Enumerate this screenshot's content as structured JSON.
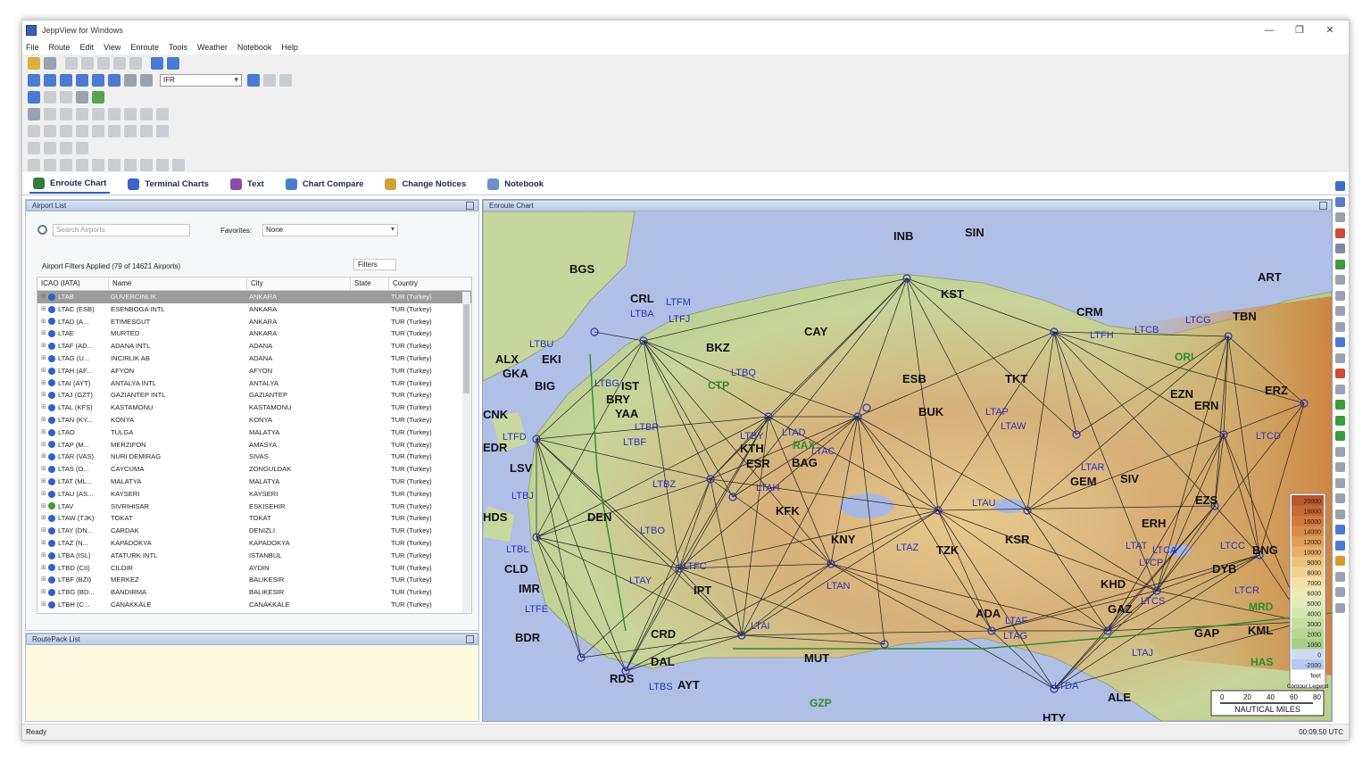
{
  "window": {
    "title": "JeppView for Windows",
    "controls": {
      "minimize": "—",
      "maximize": "❐",
      "close": "✕"
    }
  },
  "menu": [
    "File",
    "Route",
    "Edit",
    "View",
    "Enroute",
    "Tools",
    "Weather",
    "Notebook",
    "Help"
  ],
  "toolbar": {
    "layer_select": "IFR"
  },
  "tabs": [
    {
      "label": "Enroute Chart",
      "icon": "globe-icon",
      "color": "#2f7d3a"
    },
    {
      "label": "Terminal Charts",
      "icon": "terminal-charts-icon",
      "color": "#3866c6"
    },
    {
      "label": "Text",
      "icon": "text-icon",
      "color": "#8a4aa8"
    },
    {
      "label": "Chart Compare",
      "icon": "chart-compare-icon",
      "color": "#4a7bd0"
    },
    {
      "label": "Change Notices",
      "icon": "change-notices-icon",
      "color": "#d0a23a"
    },
    {
      "label": "Notebook",
      "icon": "notebook-icon",
      "color": "#6b8fc9"
    }
  ],
  "airport_panel": {
    "title": "Airport List",
    "search_placeholder": "Search Airports",
    "favorites_label": "Favorites:",
    "favorites_value": "None",
    "filter_status": "Airport Filters Applied (79 of 14621 Airports)",
    "filters_button": "Filters",
    "columns": [
      "ICAO (IATA)",
      "Name",
      "City",
      "State",
      "Country"
    ],
    "rows": [
      {
        "icao": "LTAB",
        "name": "GUVERCINLIK",
        "city": "ANKARA",
        "state": "",
        "country": "TUR (Turkey)",
        "selected": true
      },
      {
        "icao": "LTAC (ESB)",
        "name": "ESENBOGA INTL",
        "city": "ANKARA",
        "state": "",
        "country": "TUR (Turkey)"
      },
      {
        "icao": "LTAD (A...",
        "name": "ETIMESGUT",
        "city": "ANKARA",
        "state": "",
        "country": "TUR (Turkey)"
      },
      {
        "icao": "LTAE",
        "name": "MURTED",
        "city": "ANKARA",
        "state": "",
        "country": "TUR (Turkey)"
      },
      {
        "icao": "LTAF (AD...",
        "name": "ADANA INTL",
        "city": "ADANA",
        "state": "",
        "country": "TUR (Turkey)"
      },
      {
        "icao": "LTAG (U...",
        "name": "INCIRLIK AB",
        "city": "ADANA",
        "state": "",
        "country": "TUR (Turkey)"
      },
      {
        "icao": "LTAH (AF...",
        "name": "AFYON",
        "city": "AFYON",
        "state": "",
        "country": "TUR (Turkey)"
      },
      {
        "icao": "LTAI (AYT)",
        "name": "ANTALYA INTL",
        "city": "ANTALYA",
        "state": "",
        "country": "TUR (Turkey)"
      },
      {
        "icao": "LTAJ (GZT)",
        "name": "GAZIANTEP INTL",
        "city": "GAZIANTEP",
        "state": "",
        "country": "TUR (Turkey)"
      },
      {
        "icao": "LTAL (KFS)",
        "name": "KASTAMONU",
        "city": "KASTAMONU",
        "state": "",
        "country": "TUR (Turkey)"
      },
      {
        "icao": "LTAN (KY...",
        "name": "KONYA",
        "city": "KONYA",
        "state": "",
        "country": "TUR (Turkey)"
      },
      {
        "icao": "LTAO",
        "name": "TULGA",
        "city": "MALATYA",
        "state": "",
        "country": "TUR (Turkey)"
      },
      {
        "icao": "LTAP (M...",
        "name": "MERZIFON",
        "city": "AMASYA",
        "state": "",
        "country": "TUR (Turkey)"
      },
      {
        "icao": "LTAR (VAS)",
        "name": "NURI DEMIRAG",
        "city": "SIVAS",
        "state": "",
        "country": "TUR (Turkey)"
      },
      {
        "icao": "LTAS (O...",
        "name": "CAYCUMA",
        "city": "ZONGULDAK",
        "state": "",
        "country": "TUR (Turkey)"
      },
      {
        "icao": "LTAT (ML...",
        "name": "MALATYA",
        "city": "MALATYA",
        "state": "",
        "country": "TUR (Turkey)"
      },
      {
        "icao": "LTAU (AS...",
        "name": "KAYSERI",
        "city": "KAYSERI",
        "state": "",
        "country": "TUR (Turkey)"
      },
      {
        "icao": "LTAV",
        "name": "SIVRIHISAR",
        "city": "ESKISEHIR",
        "state": "",
        "country": "TUR (Turkey)",
        "alt": true
      },
      {
        "icao": "LTAW (TJK)",
        "name": "TOKAT",
        "city": "TOKAT",
        "state": "",
        "country": "TUR (Turkey)"
      },
      {
        "icao": "LTAY (DN...",
        "name": "CARDAK",
        "city": "DENIZLI",
        "state": "",
        "country": "TUR (Turkey)"
      },
      {
        "icao": "LTAZ (N...",
        "name": "KAPADOKYA",
        "city": "KAPADOKYA",
        "state": "",
        "country": "TUR (Turkey)"
      },
      {
        "icao": "LTBA (ISL)",
        "name": "ATATURK INTL",
        "city": "ISTANBUL",
        "state": "",
        "country": "TUR (Turkey)"
      },
      {
        "icao": "LTBD (CII)",
        "name": "CILDIR",
        "city": "AYDIN",
        "state": "",
        "country": "TUR (Turkey)"
      },
      {
        "icao": "LTBF (BZI)",
        "name": "MERKEZ",
        "city": "BALIKESIR",
        "state": "",
        "country": "TUR (Turkey)"
      },
      {
        "icao": "LTBG (BD...",
        "name": "BANDIRMA",
        "city": "BALIKESIR",
        "state": "",
        "country": "TUR (Turkey)"
      },
      {
        "icao": "LTBH (C...",
        "name": "CANAKKALE",
        "city": "CANAKKALE",
        "state": "",
        "country": "TUR (Turkey)"
      }
    ]
  },
  "routepack_panel": {
    "title": "RoutePack List"
  },
  "chart_panel": {
    "title": "Enroute Chart",
    "colors": {
      "sea": "#b0bfe6",
      "land_low": "#b7cf8e",
      "land_mid": "#e6d08f",
      "land_high": "#d99a52",
      "airway": "#2a2a2a",
      "label": "#2833b8"
    },
    "places_black": [
      "INB",
      "SIN",
      "BGS",
      "CRL",
      "KST",
      "ART",
      "CAY",
      "CRM",
      "TBN",
      "BKZ",
      "ALX",
      "GKA",
      "EKI",
      "ESB",
      "TKT",
      "BIG",
      "IST",
      "BRY",
      "YAA",
      "CNK",
      "BUK",
      "EZN",
      "ERN",
      "ERZ",
      "EDR",
      "KTH",
      "ESR",
      "BAG",
      "LSV",
      "GEM",
      "SIV",
      "HDS",
      "DEN",
      "KFK",
      "EZS",
      "ERH",
      "KNY",
      "TZK",
      "KSR",
      "CLD",
      "IMR",
      "IPT",
      "DYB",
      "BNG",
      "KHD",
      "GAZ",
      "ADA",
      "CRD",
      "BDR",
      "DAL",
      "MUT",
      "GAP",
      "KML",
      "RDS",
      "AYT",
      "ALE",
      "HTY"
    ],
    "places_blue": [
      "LTFM",
      "LTBA",
      "LTFJ",
      "LTBU",
      "LTFH",
      "LTCB",
      "LTCG",
      "LTBG",
      "LTBQ",
      "LTAP",
      "LTAW",
      "LTBR",
      "LTBF",
      "LTBY",
      "LTAD",
      "LTAC",
      "LTFD",
      "LTAR",
      "LTCD",
      "LTBZ",
      "LTAH",
      "LTBJ",
      "LTAU",
      "LTBO",
      "LTAZ",
      "LTAT",
      "LTCA",
      "LTCC",
      "LTCP",
      "LTFC",
      "LTAY",
      "LTAN",
      "LTCS",
      "LTCR",
      "LTBL",
      "LTFE",
      "LTAI",
      "LTAF",
      "LTAG",
      "LTAJ",
      "LTBS",
      "LTDA"
    ],
    "places_green": [
      "ORI",
      "CTP",
      "RAX",
      "MRD",
      "HAS",
      "GZP"
    ],
    "legend": {
      "levels": [
        "20000",
        "18000",
        "16000",
        "14000",
        "12000",
        "10000",
        "9000",
        "8000",
        "7000",
        "6000",
        "5000",
        "4000",
        "3000",
        "2000",
        "1000",
        "0",
        "-2000",
        "feet"
      ],
      "caption": "Contour Legend"
    },
    "scale": {
      "ticks": [
        "0",
        "20",
        "40",
        "60",
        "80"
      ],
      "caption": "NAUTICAL MILES"
    }
  },
  "status": {
    "left": "Ready",
    "right": "00:09:50 UTC"
  }
}
